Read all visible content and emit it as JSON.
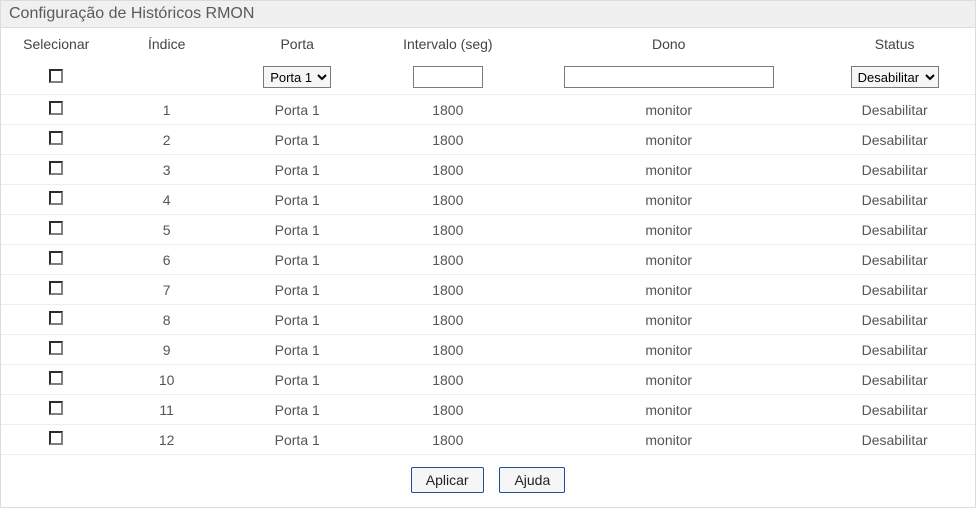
{
  "panel": {
    "title": "Configuração de Históricos RMON"
  },
  "columns": {
    "select": "Selecionar",
    "index": "Índice",
    "port": "Porta",
    "interval": "Intervalo (seg)",
    "owner": "Dono",
    "status": "Status"
  },
  "filter": {
    "port_selected": "Porta 1",
    "port_options": [
      "Porta 1"
    ],
    "interval_value": "",
    "owner_value": "",
    "status_selected": "Desabilitar",
    "status_options": [
      "Desabilitar"
    ]
  },
  "rows": [
    {
      "index": "1",
      "port": "Porta 1",
      "interval": "1800",
      "owner": "monitor",
      "status": "Desabilitar"
    },
    {
      "index": "2",
      "port": "Porta 1",
      "interval": "1800",
      "owner": "monitor",
      "status": "Desabilitar"
    },
    {
      "index": "3",
      "port": "Porta 1",
      "interval": "1800",
      "owner": "monitor",
      "status": "Desabilitar"
    },
    {
      "index": "4",
      "port": "Porta 1",
      "interval": "1800",
      "owner": "monitor",
      "status": "Desabilitar"
    },
    {
      "index": "5",
      "port": "Porta 1",
      "interval": "1800",
      "owner": "monitor",
      "status": "Desabilitar"
    },
    {
      "index": "6",
      "port": "Porta 1",
      "interval": "1800",
      "owner": "monitor",
      "status": "Desabilitar"
    },
    {
      "index": "7",
      "port": "Porta 1",
      "interval": "1800",
      "owner": "monitor",
      "status": "Desabilitar"
    },
    {
      "index": "8",
      "port": "Porta 1",
      "interval": "1800",
      "owner": "monitor",
      "status": "Desabilitar"
    },
    {
      "index": "9",
      "port": "Porta 1",
      "interval": "1800",
      "owner": "monitor",
      "status": "Desabilitar"
    },
    {
      "index": "10",
      "port": "Porta 1",
      "interval": "1800",
      "owner": "monitor",
      "status": "Desabilitar"
    },
    {
      "index": "11",
      "port": "Porta 1",
      "interval": "1800",
      "owner": "monitor",
      "status": "Desabilitar"
    },
    {
      "index": "12",
      "port": "Porta 1",
      "interval": "1800",
      "owner": "monitor",
      "status": "Desabilitar"
    }
  ],
  "buttons": {
    "apply": "Aplicar",
    "help": "Ajuda"
  }
}
